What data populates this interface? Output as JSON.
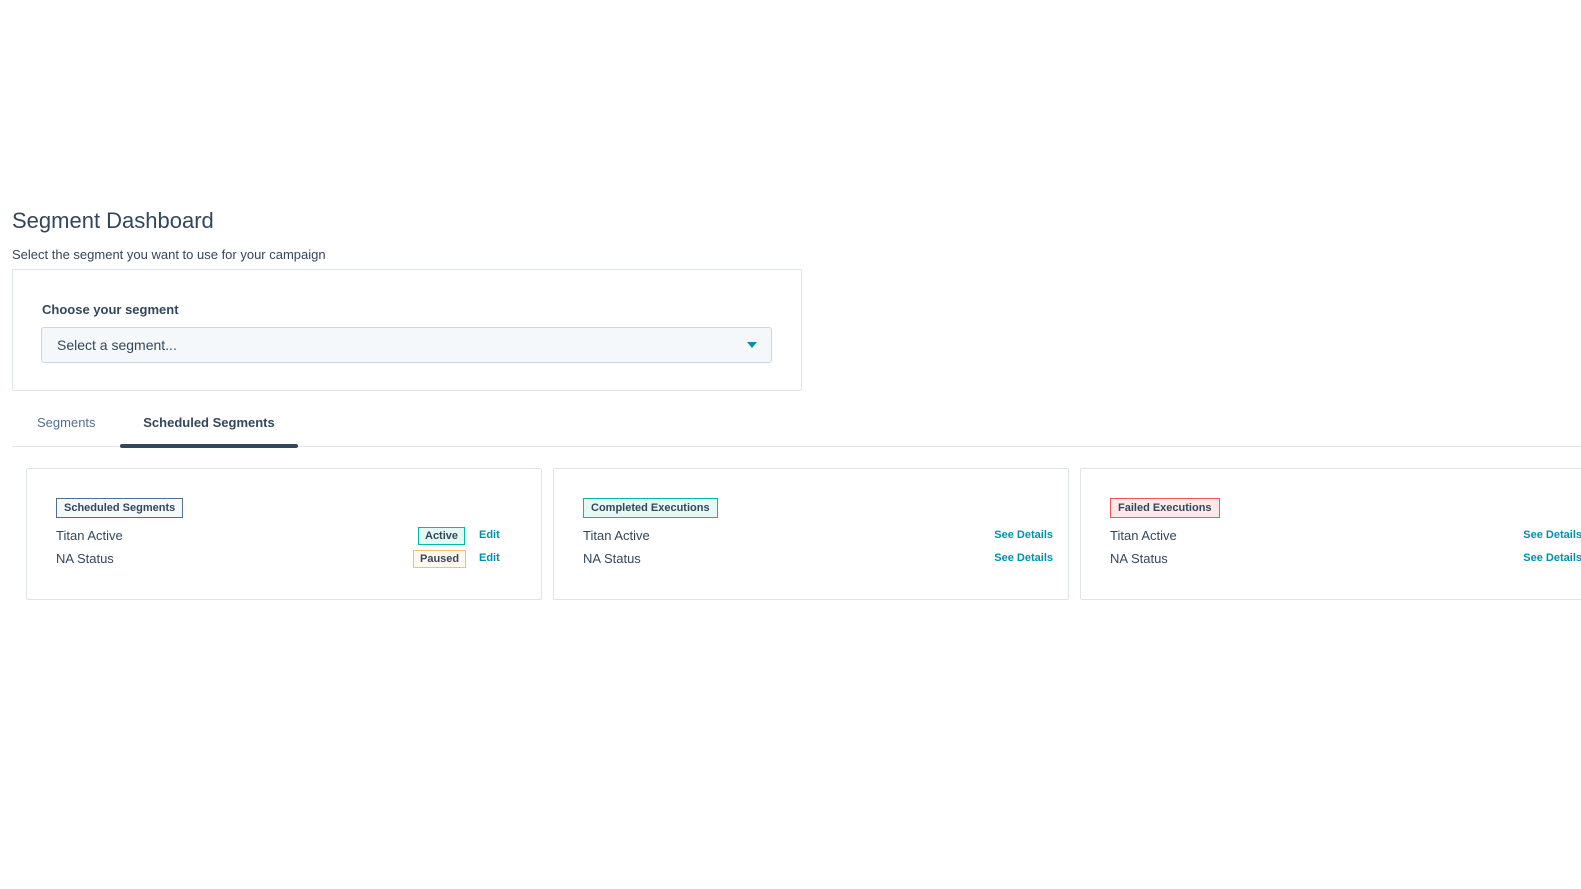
{
  "header": {
    "title": "Segment Dashboard",
    "subtitle": "Select the segment you want to use for your campaign"
  },
  "segment_picker": {
    "label": "Choose your segment",
    "placeholder": "Select a segment..."
  },
  "tabs": [
    {
      "label": "Segments",
      "active": false
    },
    {
      "label": "Scheduled Segments",
      "active": true
    }
  ],
  "cards": {
    "scheduled": {
      "tag": "Scheduled Segments",
      "rows": [
        {
          "name": "Titan Active",
          "status": "Active",
          "action": "Edit"
        },
        {
          "name": "NA Status",
          "status": "Paused",
          "action": "Edit"
        }
      ]
    },
    "completed": {
      "tag": "Completed Executions",
      "rows": [
        {
          "name": "Titan Active",
          "action": "See Details"
        },
        {
          "name": "NA Status",
          "action": "See Details"
        }
      ]
    },
    "failed": {
      "tag": "Failed Executions",
      "rows": [
        {
          "name": "Titan Active",
          "action": "See Details"
        },
        {
          "name": "NA Status",
          "action": "See Details"
        }
      ]
    }
  },
  "colors": {
    "text": "#33475b",
    "link": "#0091ae",
    "active_border": "#00bda5",
    "paused_border": "#f5c26b",
    "failed_border": "#f2545b"
  },
  "icons": {
    "select_caret": "caret-down-icon"
  }
}
